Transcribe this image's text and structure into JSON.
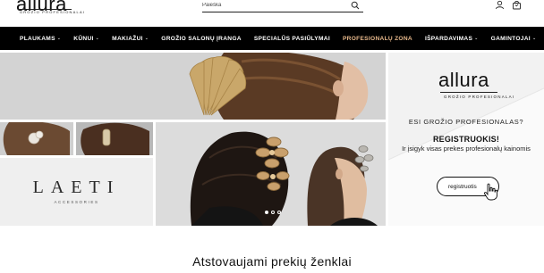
{
  "header": {
    "logo_text": "allura",
    "logo_sub": "GROŽIO PROFESIONALAI",
    "search_placeholder": "Paieška"
  },
  "nav": {
    "items": [
      {
        "label": "PLAUKAMS",
        "has_menu": true
      },
      {
        "label": "KŪNUI",
        "has_menu": true
      },
      {
        "label": "MAKIAŽUI",
        "has_menu": true
      },
      {
        "label": "GROŽIO SALONŲ ĮRANGA",
        "has_menu": false
      },
      {
        "label": "SPECIALŪS PASIŪLYMAI",
        "has_menu": false
      },
      {
        "label": "PROFESIONALŲ ZONA",
        "has_menu": false,
        "accent": true
      },
      {
        "label": "IŠPARDAVIMAS",
        "has_menu": true
      },
      {
        "label": "GAMINTOJAI",
        "has_menu": true
      }
    ],
    "chevron": "⌄",
    "accent_color": "#e8b98c"
  },
  "hero": {
    "laeti_title": "LAETI",
    "laeti_sub": "ACCESSORIES",
    "carousel_dots": 3,
    "active_dot": 0
  },
  "promo": {
    "logo_text": "allura",
    "logo_sub": "GROŽIO PROFESIONALAI",
    "question": "ESI GROŽIO PROFESIONALAS?",
    "headline": "REGISTRUOKIS!",
    "description": "Ir įsigyk visas prekes profesionalų kainomis",
    "button_label": "registruotis"
  },
  "brands": {
    "title": "Atstovaujami prekių ženklai"
  }
}
